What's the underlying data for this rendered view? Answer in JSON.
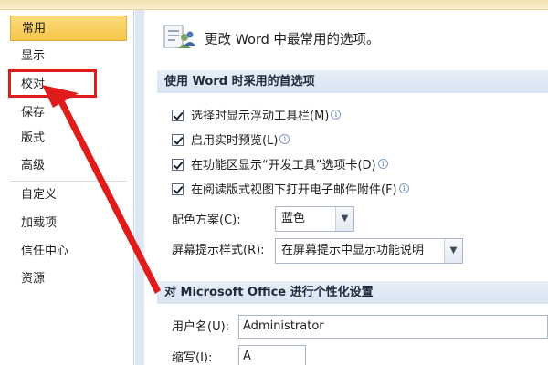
{
  "sidebar": {
    "items": [
      {
        "label": "常用",
        "selected": true
      },
      {
        "label": "显示"
      },
      {
        "label": "校对"
      },
      {
        "label": "保存"
      },
      {
        "label": "版式"
      },
      {
        "label": "高级"
      },
      {
        "label": "自定义"
      },
      {
        "label": "加载项"
      },
      {
        "label": "信任中心"
      },
      {
        "label": "资源"
      }
    ]
  },
  "header": {
    "text": "更改 Word 中最常用的选项。",
    "icon": "settings-people-icon"
  },
  "section1": {
    "title": "使用 Word 时采用的首选项",
    "options": [
      {
        "label": "选择时显示浮动工具栏(M)",
        "checked": true
      },
      {
        "label": "启用实时预览(L)",
        "checked": true
      },
      {
        "label": "在功能区显示“开发工具”选项卡(D)",
        "checked": true
      },
      {
        "label": "在阅读版式视图下打开电子邮件附件(F)",
        "checked": true
      }
    ],
    "color_scheme": {
      "label": "配色方案(C):",
      "value": "蓝色"
    },
    "screentip": {
      "label": "屏幕提示样式(R):",
      "value": "在屏幕提示中显示功能说明"
    }
  },
  "section2": {
    "title": "对 Microsoft Office 进行个性化设置",
    "username": {
      "label": "用户名(U):",
      "value": "Administrator"
    },
    "initials": {
      "label": "缩写(I):",
      "value": "A"
    }
  },
  "annotation": {
    "color": "#e01b1b"
  },
  "colors": {
    "accent": "#f7c54a",
    "section_bg": "#dde6f1",
    "annotation_red": "#e01b1b"
  }
}
